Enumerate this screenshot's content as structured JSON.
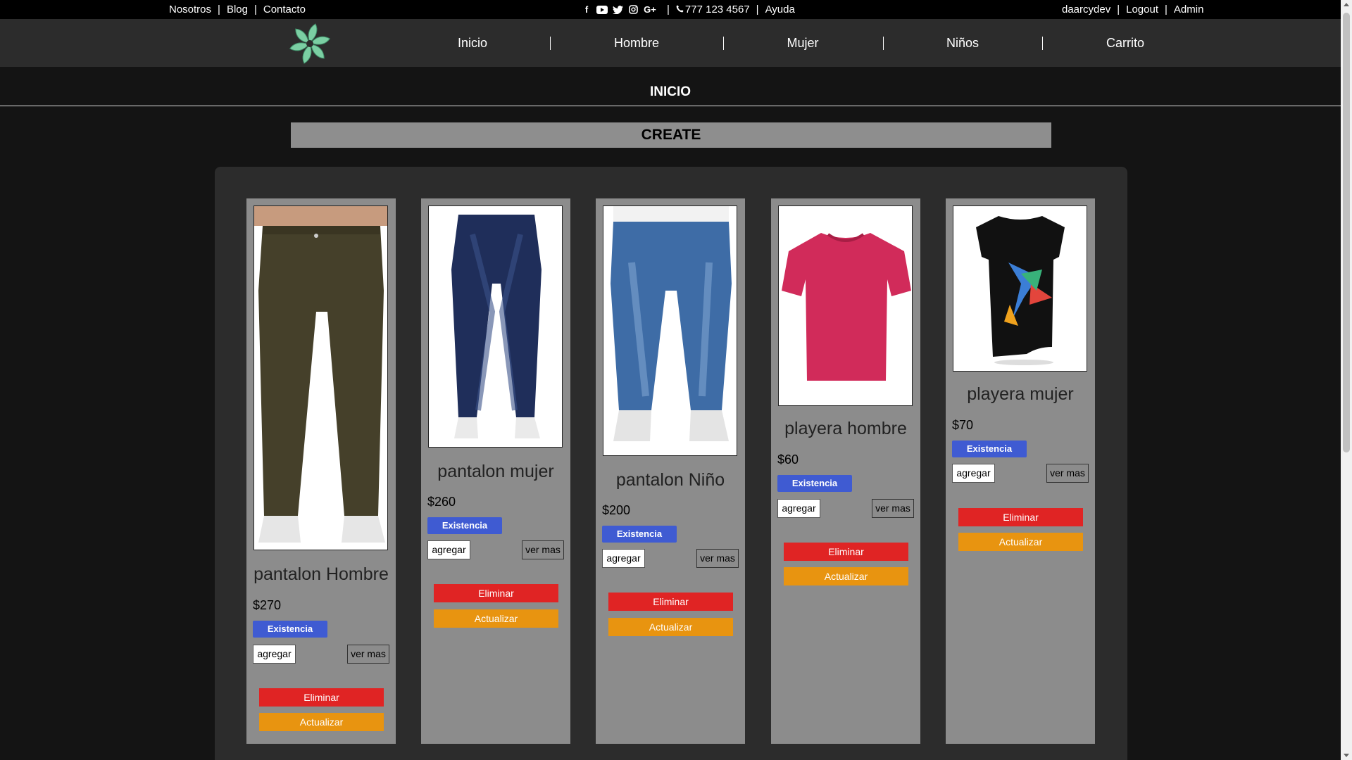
{
  "topbar": {
    "left_links": [
      "Nosotros",
      "Blog",
      "Contacto"
    ],
    "social_icons": [
      "facebook-icon",
      "youtube-icon",
      "twitter-icon",
      "instagram-icon",
      "google-plus-icon"
    ],
    "phone": "777 123 4567",
    "help": "Ayuda",
    "user": "daarcydev",
    "logout": "Logout",
    "admin": "Admin"
  },
  "nav": {
    "logo_icon": "spiral-leaf-logo-icon",
    "items": [
      "Inicio",
      "Hombre",
      "Mujer",
      "Niños",
      "Carrito"
    ]
  },
  "page": {
    "title": "INICIO",
    "create_label": "CREATE"
  },
  "colors": {
    "badge": "#3f5bd2",
    "eliminar": "#e02424",
    "actualizar": "#e89410",
    "card_bg": "#8c8c8c"
  },
  "products": [
    {
      "name": "pantalon Hombre",
      "price": "$270",
      "stock_label": "Existencia",
      "add_label": "agregar",
      "more_label": "ver mas",
      "delete_label": "Eliminar",
      "update_label": "Actualizar",
      "image": "khaki-pants-icon"
    },
    {
      "name": "pantalon mujer",
      "price": "$260",
      "stock_label": "Existencia",
      "add_label": "agregar",
      "more_label": "ver mas",
      "delete_label": "Eliminar",
      "update_label": "Actualizar",
      "image": "womens-jeans-icon"
    },
    {
      "name": "pantalon Niño",
      "price": "$200",
      "stock_label": "Existencia",
      "add_label": "agregar",
      "more_label": "ver mas",
      "delete_label": "Eliminar",
      "update_label": "Actualizar",
      "image": "kids-jeans-icon"
    },
    {
      "name": "playera hombre",
      "price": "$60",
      "stock_label": "Existencia",
      "add_label": "agregar",
      "more_label": "ver mas",
      "delete_label": "Eliminar",
      "update_label": "Actualizar",
      "image": "red-tshirt-icon"
    },
    {
      "name": "playera mujer",
      "price": "$70",
      "stock_label": "Existencia",
      "add_label": "agregar",
      "more_label": "ver mas",
      "delete_label": "Eliminar",
      "update_label": "Actualizar",
      "image": "black-hummingbird-shirt-icon"
    }
  ]
}
